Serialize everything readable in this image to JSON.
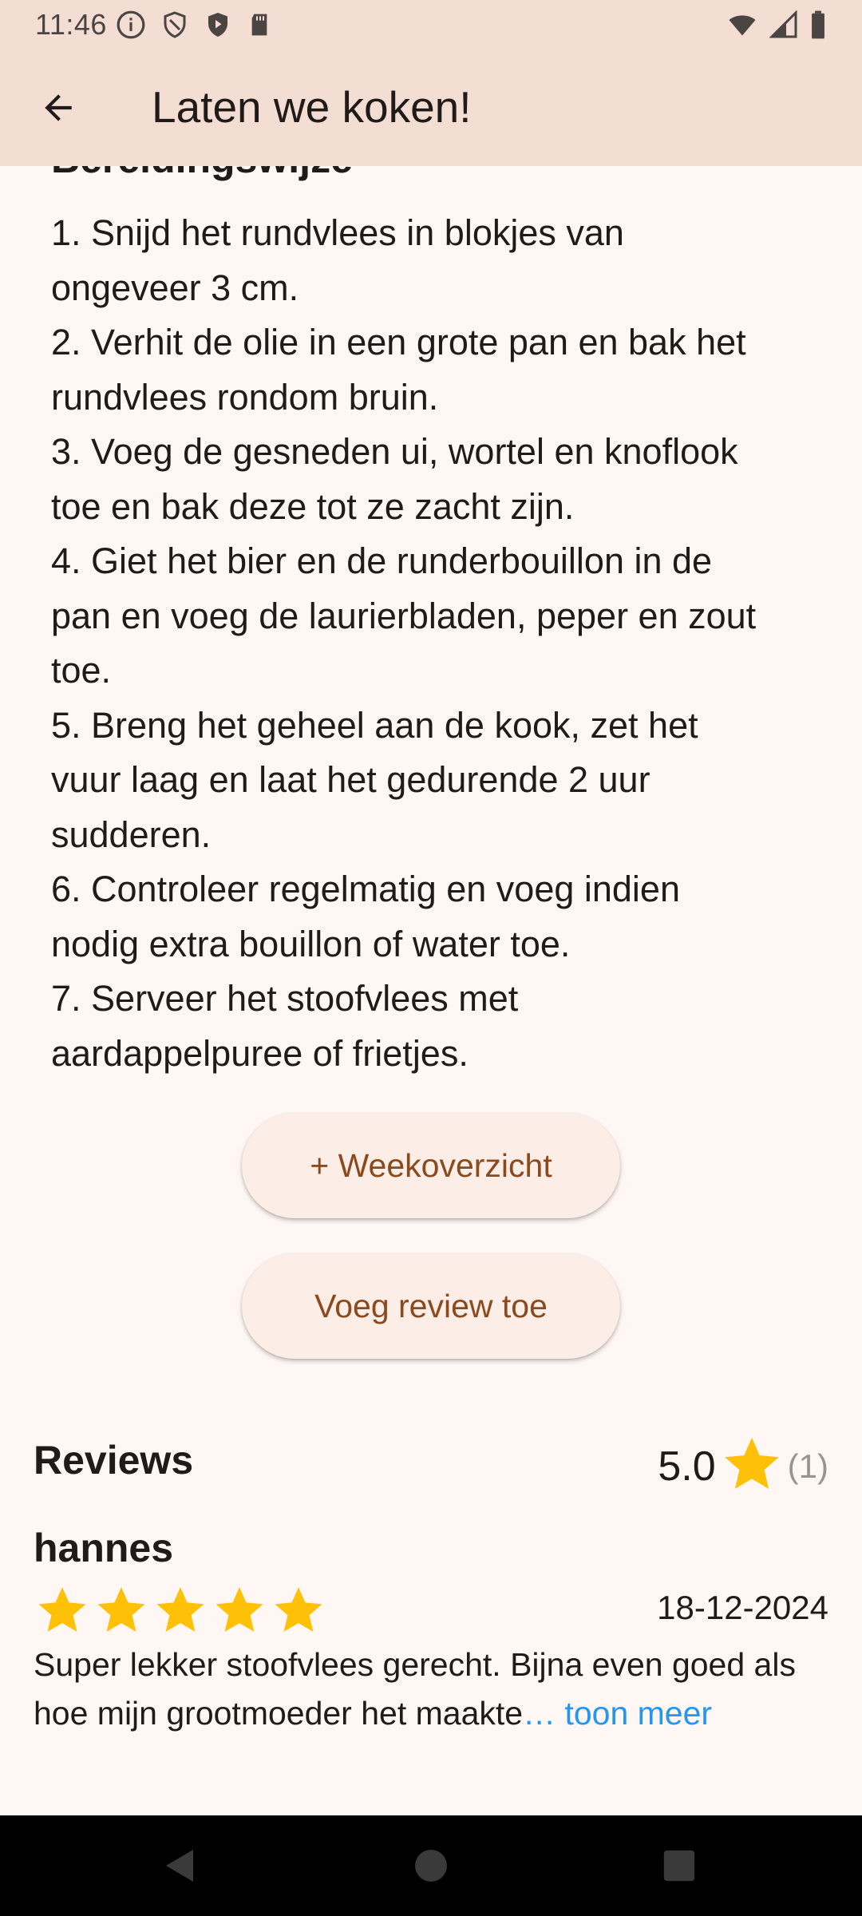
{
  "status_bar": {
    "time": "11:46",
    "icons_left": [
      "info-icon",
      "shield-outline-icon",
      "shield-play-icon",
      "sd-card-icon"
    ],
    "icons_right": [
      "wifi-icon",
      "signal-icon",
      "battery-icon"
    ]
  },
  "app_bar": {
    "title": "Laten we koken!"
  },
  "section": {
    "partial_heading": "Bereidingswijze"
  },
  "steps": [
    "1. Snijd het rundvlees in blokjes van",
    "ongeveer 3 cm.",
    "2. Verhit de olie in een grote pan en bak het",
    "rundvlees rondom bruin.",
    "3. Voeg de gesneden ui, wortel en knoflook",
    "toe en bak deze tot ze zacht zijn.",
    "4. Giet het bier en de runderbouillon in de",
    "pan en voeg de laurierbladen, peper en zout",
    "toe.",
    "5. Breng het geheel aan de kook, zet het",
    "vuur laag en laat het gedurende 2 uur",
    "sudderen.",
    "6. Controleer regelmatig en voeg indien",
    "nodig extra bouillon of water toe.",
    "7. Serveer het stoofvlees met",
    "aardappelpuree of frietjes."
  ],
  "buttons": {
    "weekoverzicht": "+ Weekoverzicht",
    "add_review": "Voeg review toe"
  },
  "reviews": {
    "title": "Reviews",
    "average": "5.0",
    "count": "(1)",
    "items": [
      {
        "author": "hannes",
        "stars": 5,
        "date": "18-12-2024",
        "text": "Super lekker stoofvlees gerecht. Bijna even goed als hoe mijn grootmoeder het maakte",
        "more": "… toon meer"
      }
    ]
  },
  "colors": {
    "app_bar": "#F4DDD3",
    "background": "#FFF7F4",
    "button_bg": "#FCEDE6",
    "button_text": "#8B4A1E",
    "star": "#FFC107",
    "link": "#2196F3"
  }
}
